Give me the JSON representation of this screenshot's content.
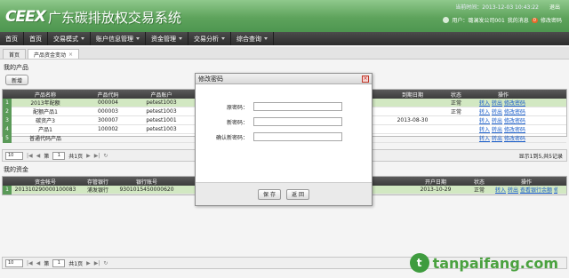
{
  "header": {
    "logo": "CEEX",
    "title": "广东碳排放权交易系统",
    "time_label": "当前时间：2013-12-03 10:43:22",
    "exit": "退出",
    "user_text": "用户：璐澜发公司001",
    "messages": "我的消息",
    "msg_count": "0",
    "change_pwd": "修改密码"
  },
  "menu": [
    {
      "label": "首页",
      "caret": false
    },
    {
      "label": "首页",
      "caret": false
    },
    {
      "label": "交易模式",
      "caret": true
    },
    {
      "label": "账户信息管理",
      "caret": true
    },
    {
      "label": "资金管理",
      "caret": true
    },
    {
      "label": "交易分析",
      "caret": true
    },
    {
      "label": "综合查询",
      "caret": true
    }
  ],
  "tabs": [
    {
      "label": "首页",
      "active": false,
      "closable": false
    },
    {
      "label": "产品资金变动",
      "active": true,
      "closable": true
    }
  ],
  "products": {
    "section_title": "我的产品",
    "add_button": "新增",
    "columns": [
      "",
      "产品名称",
      "产品代码",
      "产品账户",
      "",
      "",
      "到期日期",
      "状态",
      "操作"
    ],
    "rows": [
      {
        "num": "1",
        "name": "2013年配额",
        "code": "000004",
        "account": "petest1003",
        "c5": "",
        "c6": "有",
        "due": "",
        "status": "正常",
        "ops": [
          "转入",
          "转出",
          "修改密码"
        ],
        "selected": true
      },
      {
        "num": "2",
        "name": "配额产品1",
        "code": "000003",
        "account": "petest1003",
        "c5": "",
        "c6": "有",
        "due": "",
        "status": "正常",
        "ops": [
          "转入",
          "转出",
          "修改密码"
        ],
        "selected": false
      },
      {
        "num": "3",
        "name": "碳资产3",
        "code": "300007",
        "account": "petest1001",
        "c5": "",
        "c6": "",
        "due": "2013-08-30",
        "status": "",
        "ops": [
          "转入",
          "转出",
          "修改密码"
        ],
        "selected": false
      },
      {
        "num": "4",
        "name": "产品1",
        "code": "100002",
        "account": "petest1003",
        "c5": "",
        "c6": "",
        "due": "",
        "status": "",
        "ops": [
          "转入",
          "转出",
          "修改密码"
        ],
        "selected": false
      },
      {
        "num": "5",
        "name": "普通代码产品",
        "code": "",
        "account": "",
        "c5": "",
        "c6": "",
        "due": "",
        "status": "",
        "ops": [
          "转入",
          "转出",
          "修改密码"
        ],
        "selected": false
      }
    ],
    "pager": {
      "page_size": "10",
      "page_label": "第",
      "page": "1",
      "total_pages": "共1页",
      "info": "显示1到5,共5记录"
    }
  },
  "funds": {
    "section_title": "我的资金",
    "columns": [
      "",
      "资金帐号",
      "存管银行",
      "银行账号",
      "",
      "",
      "开户日期",
      "状态",
      "操作"
    ],
    "rows": [
      {
        "num": "1",
        "account": "201310290000100083",
        "bank": "浦发银行",
        "bank_acct": "9301015450000620",
        "c5": "",
        "c6": "",
        "open_date": "2013-10-29",
        "status": "正常",
        "ops": [
          "转入",
          "转出",
          "查看银行余额",
          "修改密码"
        ],
        "selected": true
      }
    ],
    "pager": {
      "page_size": "10",
      "page_label": "第",
      "page": "1",
      "total_pages": "共1页"
    }
  },
  "dialog": {
    "title": "修改密码",
    "close": "×",
    "fields": [
      {
        "label": "原密码："
      },
      {
        "label": "新密码："
      },
      {
        "label": "确认新密码："
      }
    ],
    "save": "保 存",
    "back": "返 回"
  },
  "watermark": {
    "logo": "t",
    "text": "tanpaifang.com"
  }
}
